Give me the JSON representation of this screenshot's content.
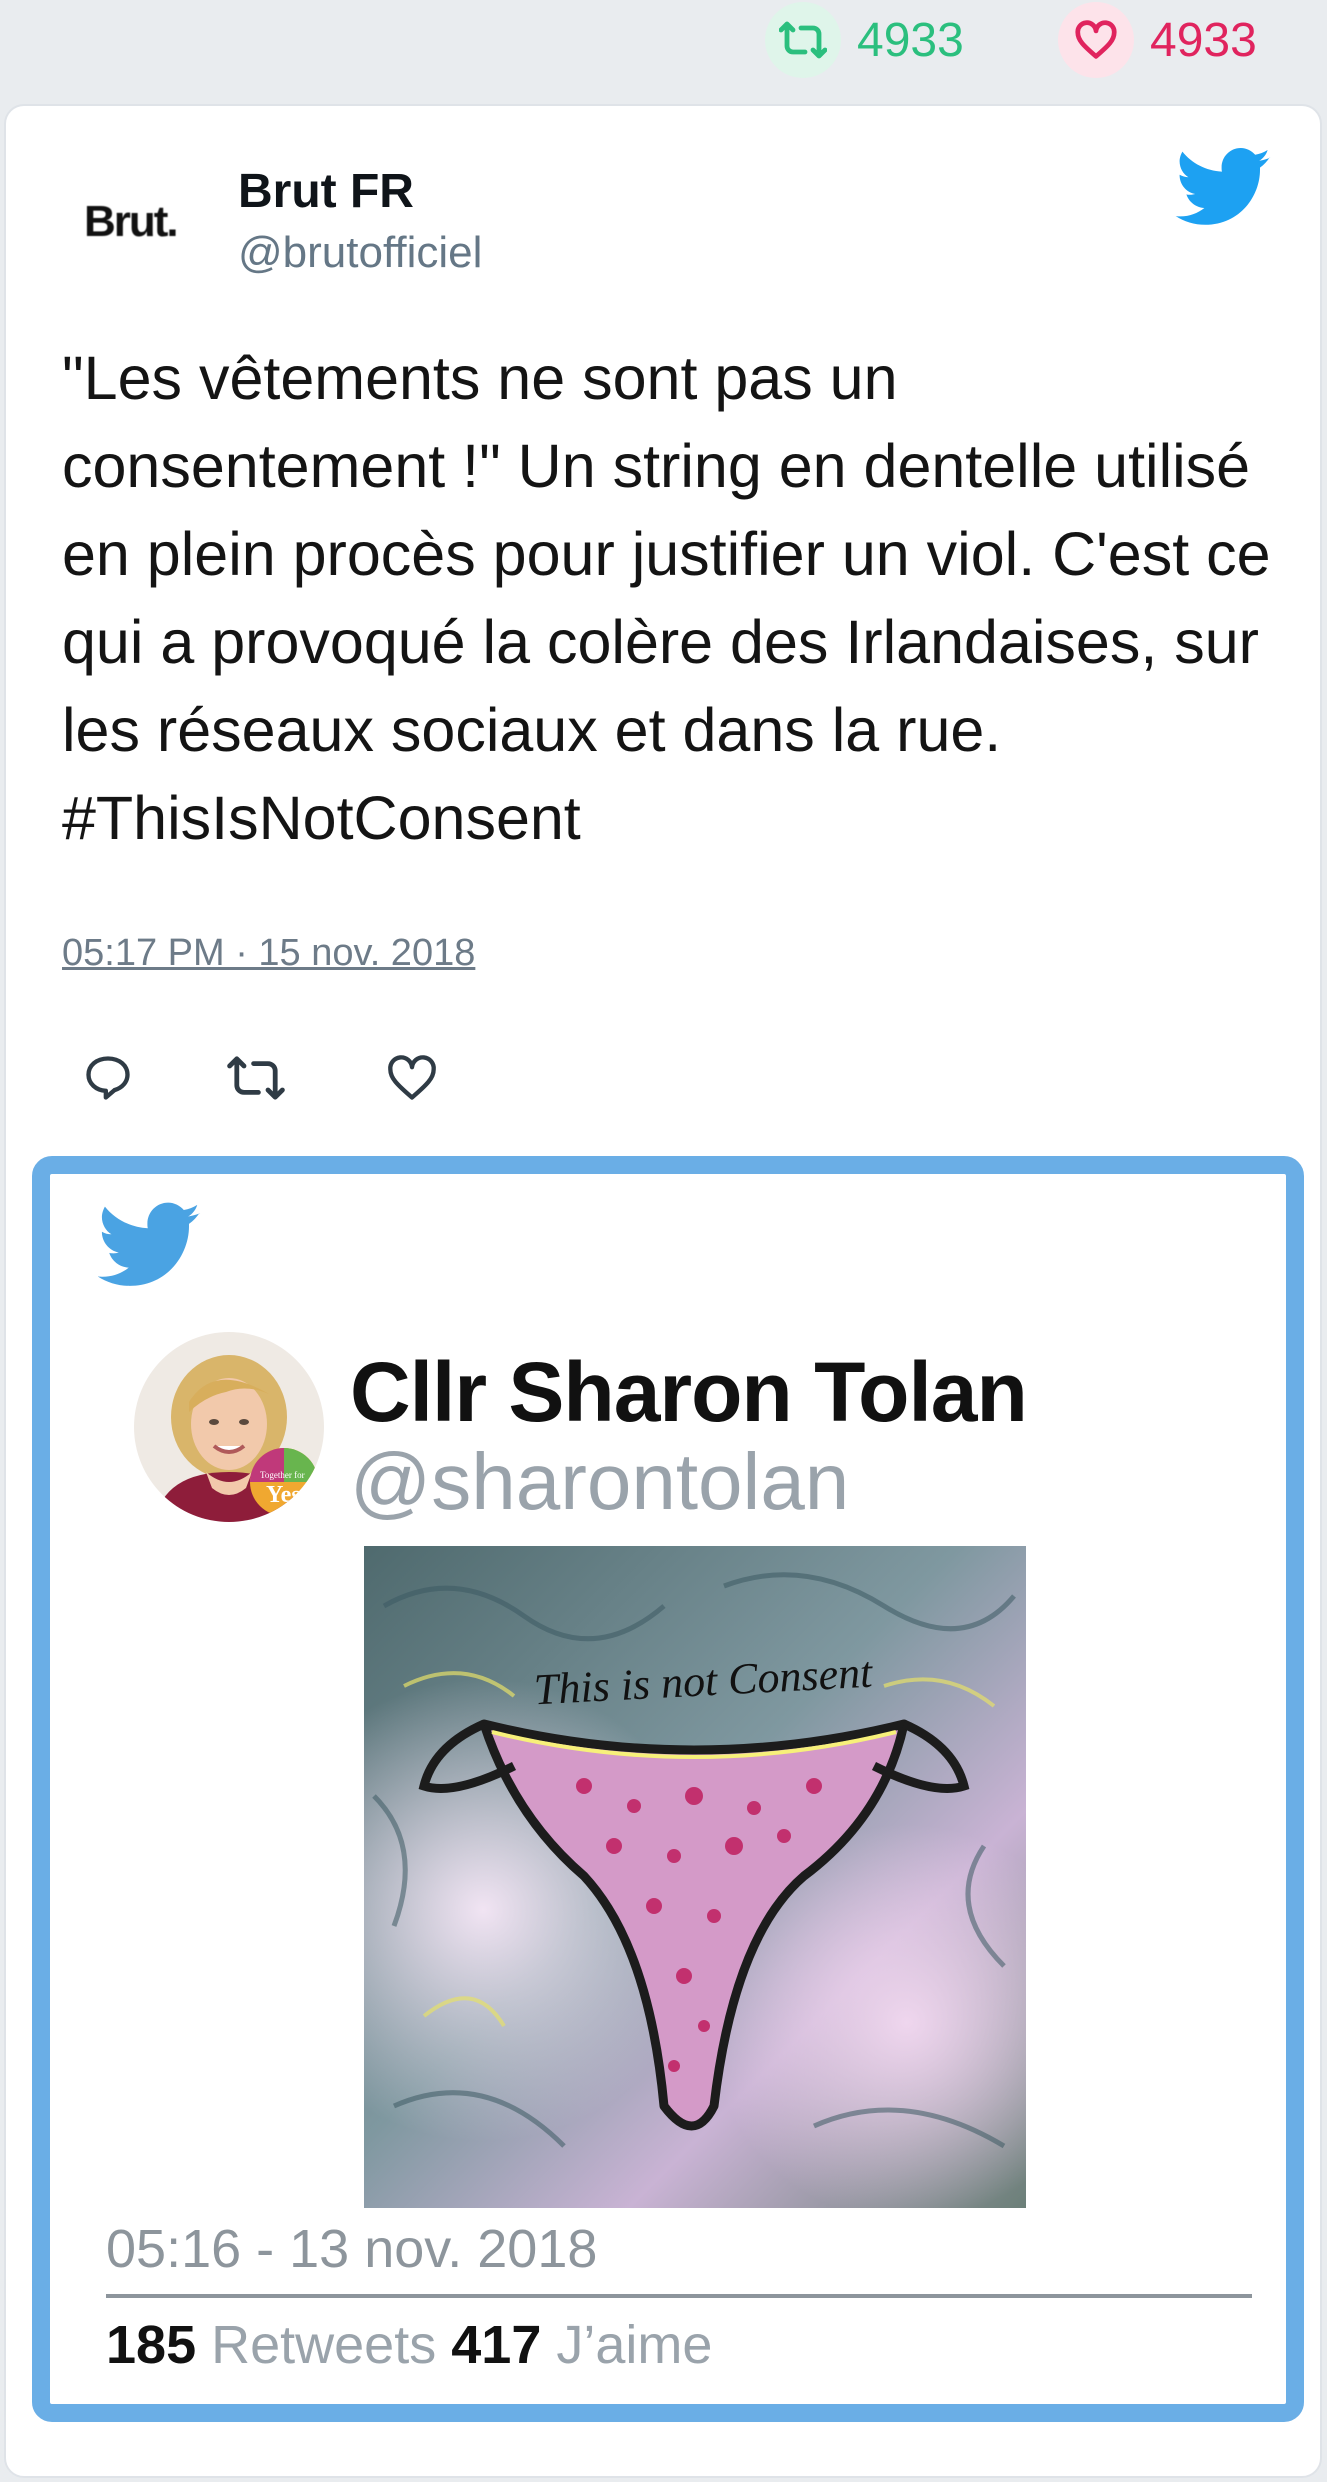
{
  "top_stats": {
    "retweet_count": "4933",
    "like_count": "4933",
    "retweet_icon": "retweet-icon",
    "like_icon": "heart-icon",
    "retweet_color": "#2bbf7e",
    "like_color": "#e0245e"
  },
  "tweet": {
    "logo_text": "Brut.",
    "author_name": "Brut FR",
    "author_handle": "@brutofficiel",
    "text": "\"Les vêtements ne sont pas un consentement !\" Un string en dentelle utilisé en plein procès pour justifier un viol. C'est ce qui a provoqué la colère des Irlandaises, sur les réseaux sociaux et dans la rue. #ThisIsNotConsent",
    "timestamp": "05:17 PM · 15 nov. 2018",
    "actions": [
      "reply-icon",
      "retweet-icon",
      "heart-icon"
    ],
    "brand_color": "#1da1f2"
  },
  "embedded_tweet": {
    "author_name": "Cllr Sharon Tolan",
    "author_handle": "@sharontolan",
    "avatar_badge_text": "Yes",
    "avatar_badge_small": "Together for",
    "image_caption": "This is not Consent",
    "timestamp": "05:16 - 13 nov. 2018",
    "retweets_count": "185",
    "retweets_label": "Retweets",
    "likes_count": "417",
    "likes_label": "J’aime",
    "frame_color": "#6aaee6"
  }
}
